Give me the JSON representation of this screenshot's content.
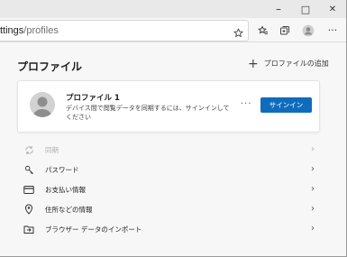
{
  "window": {
    "controls": {
      "minimize": "–",
      "maximize": "□",
      "close": "✕"
    }
  },
  "address_bar": {
    "visible_prefix": "ttings",
    "path": "/profiles"
  },
  "toolbar_icons": [
    "star-outline-icon",
    "favorites-icon",
    "collections-icon",
    "profile-icon",
    "more-icon"
  ],
  "page": {
    "title": "プロファイル",
    "add_profile_label": "プロファイルの追加"
  },
  "profile_card": {
    "name": "プロファイル 1",
    "description": "デバイス間で閲覧データを同期するには、サインインしてください",
    "more_label": "···",
    "signin_label": "サインイン"
  },
  "settings_list": [
    {
      "label": "同期",
      "icon": "sync-icon",
      "enabled": false
    },
    {
      "label": "パスワード",
      "icon": "key-icon",
      "enabled": true
    },
    {
      "label": "お支払い情報",
      "icon": "credit-card-icon",
      "enabled": true
    },
    {
      "label": "住所などの情報",
      "icon": "location-pin-icon",
      "enabled": true
    },
    {
      "label": "ブラウザー データのインポート",
      "icon": "import-icon",
      "enabled": true
    }
  ],
  "colors": {
    "accent": "#0f6cbd",
    "page_bg": "#f7f7f7",
    "disabled_text": "#b0b0b0"
  }
}
